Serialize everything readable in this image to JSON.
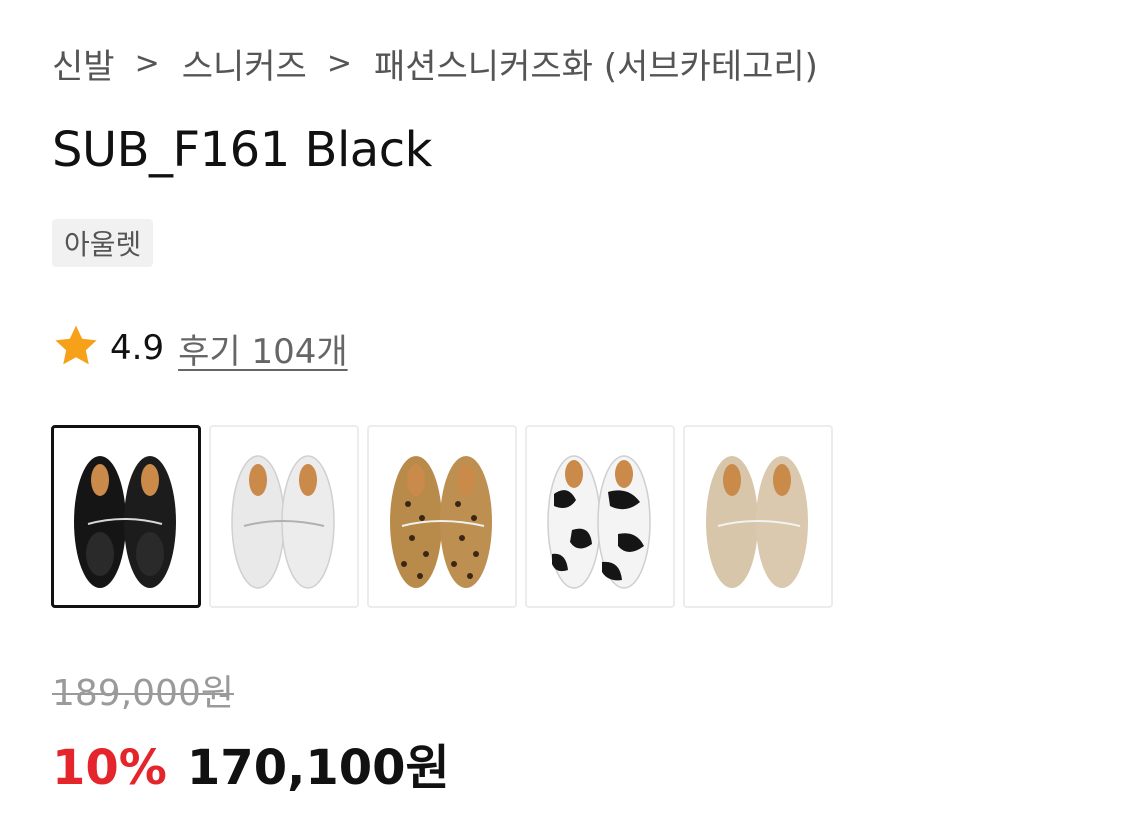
{
  "breadcrumb": {
    "items": [
      "신발",
      "스니커즈",
      "패션스니커즈화 (서브카테고리)"
    ],
    "separator": ">"
  },
  "product": {
    "title": "SUB_F161 Black",
    "badge": "아울렛"
  },
  "rating": {
    "value": "4.9",
    "reviews_label": "후기 104개",
    "star_color": "#f7a11a"
  },
  "color_options": {
    "selected_index": 0,
    "items": [
      {
        "name": "black-shoe-thumbnail",
        "color": "#111111"
      },
      {
        "name": "white-shoe-thumbnail",
        "color": "#eeeeee"
      },
      {
        "name": "leopard-shoe-thumbnail",
        "color": "#b88a4a"
      },
      {
        "name": "cow-print-shoe-thumbnail",
        "color": "#1a1a1a"
      },
      {
        "name": "beige-shoe-thumbnail",
        "color": "#d9c8ad"
      }
    ]
  },
  "price": {
    "original": "189,000원",
    "discount": "10%",
    "sale": "170,100원",
    "discount_color": "#e4262c"
  }
}
